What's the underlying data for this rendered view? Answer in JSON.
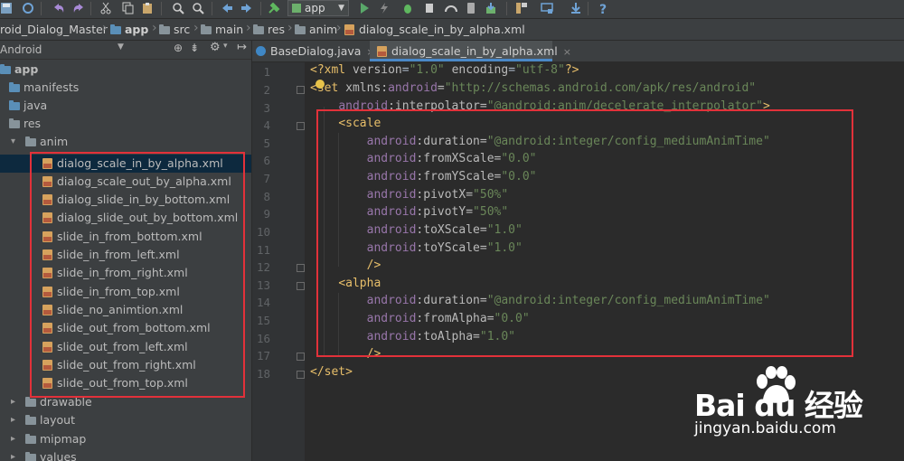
{
  "toolbar": {
    "run_config": "app"
  },
  "breadcrumb": {
    "items": [
      "roid_Dialog_Master",
      "app",
      "src",
      "main",
      "res",
      "anim",
      "dialog_scale_in_by_alpha.xml"
    ]
  },
  "project_panel": {
    "view_mode": "Android",
    "tree": [
      "app",
      "manifests",
      "java",
      "res",
      "anim",
      "dialog_scale_in_by_alpha.xml",
      "dialog_scale_out_by_alpha.xml",
      "dialog_slide_in_by_bottom.xml",
      "dialog_slide_out_by_bottom.xml",
      "slide_in_from_bottom.xml",
      "slide_in_from_left.xml",
      "slide_in_from_right.xml",
      "slide_in_from_top.xml",
      "slide_no_animtion.xml",
      "slide_out_from_bottom.xml",
      "slide_out_from_left.xml",
      "slide_out_from_right.xml",
      "slide_out_from_top.xml",
      "drawable",
      "layout",
      "mipmap",
      "values"
    ]
  },
  "tabs": [
    "BaseDialog.java",
    "dialog_scale_in_by_alpha.xml"
  ],
  "editor": {
    "line_numbers": [
      "1",
      "2",
      "3",
      "4",
      "5",
      "6",
      "7",
      "8",
      "9",
      "10",
      "11",
      "12",
      "13",
      "14",
      "15",
      "16",
      "17",
      "18"
    ],
    "tokens": {
      "l1_open": "<?",
      "l1_xml": "xml",
      "l1_sp1": " ",
      "l1_version": "version",
      "l1_eq1": "=",
      "l1_version_val": "\"1.0\"",
      "l1_sp2": " ",
      "l1_encoding": "encoding",
      "l1_eq2": "=",
      "l1_encoding_val": "\"utf-8\"",
      "l1_close": "?>",
      "l2_tag": "<set",
      "l2_sp": " ",
      "l2_xmlns": "xmlns:",
      "l2_android": "android",
      "l2_eq": "=",
      "l2_val": "\"http://schemas.android.com/apk/res/android\"",
      "l3_ns": "android",
      "l3_attr": ":interpolator=",
      "l3_val": "\"@android:anim/decelerate_interpolator\"",
      "l3_close": ">",
      "l4_tag": "<scale",
      "l5_ns": "android",
      "l5_attr": ":duration=",
      "l5_val": "\"@android:integer/config_mediumAnimTime\"",
      "l6_ns": "android",
      "l6_attr": ":fromXScale=",
      "l6_val": "\"0.0\"",
      "l7_ns": "android",
      "l7_attr": ":fromYScale=",
      "l7_val": "\"0.0\"",
      "l8_ns": "android",
      "l8_attr": ":pivotX=",
      "l8_val": "\"50%\"",
      "l9_ns": "android",
      "l9_attr": ":pivotY=",
      "l9_val": "\"50%\"",
      "l10_ns": "android",
      "l10_attr": ":toXScale=",
      "l10_val": "\"1.0\"",
      "l11_ns": "android",
      "l11_attr": ":toYScale=",
      "l11_val": "\"1.0\"",
      "l12_close": "/>",
      "l13_tag": "<alpha",
      "l14_ns": "android",
      "l14_attr": ":duration=",
      "l14_val": "\"@android:integer/config_mediumAnimTime\"",
      "l15_ns": "android",
      "l15_attr": ":fromAlpha=",
      "l15_val": "\"0.0\"",
      "l16_ns": "android",
      "l16_attr": ":toAlpha=",
      "l16_val": "\"1.0\"",
      "l17_close": "/>",
      "l18_tag": "</set>"
    }
  },
  "watermark": {
    "brand": "Bai du 经验",
    "url": "jingyan.baidu.com"
  }
}
